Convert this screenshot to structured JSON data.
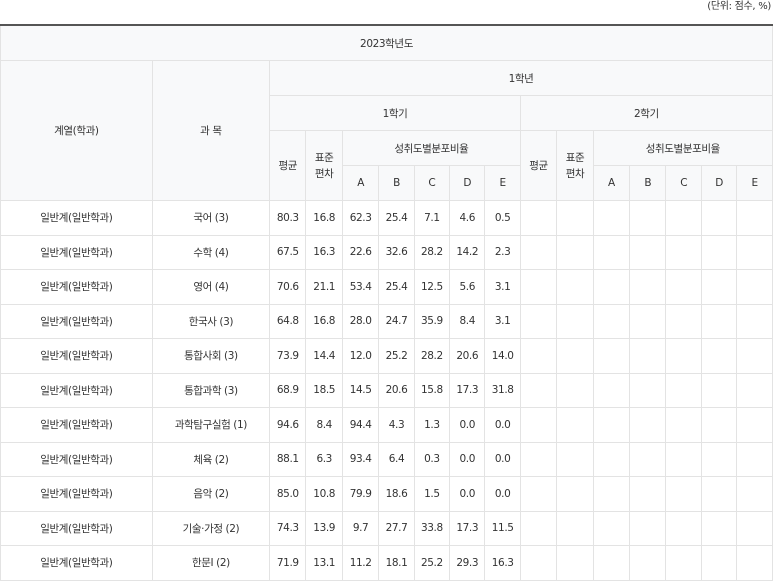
{
  "unit_note": "(단위: 점수, %)",
  "header": {
    "year": "2023학년도",
    "track_col": "계열(학과)",
    "subject_col": "과 목",
    "grade": "1학년",
    "semester1": "1학기",
    "semester2": "2학기",
    "avg": "평균",
    "std_line1": "표준",
    "std_line2": "편차",
    "dist": "성취도별분포비율",
    "levels": [
      "A",
      "B",
      "C",
      "D",
      "E"
    ]
  },
  "rows": [
    {
      "track": "일반계(일반학과)",
      "subject": "국어 (3)",
      "avg": "80.3",
      "std": "16.8",
      "a": "62.3",
      "b": "25.4",
      "c": "7.1",
      "d": "4.6",
      "e": "0.5"
    },
    {
      "track": "일반계(일반학과)",
      "subject": "수학 (4)",
      "avg": "67.5",
      "std": "16.3",
      "a": "22.6",
      "b": "32.6",
      "c": "28.2",
      "d": "14.2",
      "e": "2.3"
    },
    {
      "track": "일반계(일반학과)",
      "subject": "영어 (4)",
      "avg": "70.6",
      "std": "21.1",
      "a": "53.4",
      "b": "25.4",
      "c": "12.5",
      "d": "5.6",
      "e": "3.1"
    },
    {
      "track": "일반계(일반학과)",
      "subject": "한국사 (3)",
      "avg": "64.8",
      "std": "16.8",
      "a": "28.0",
      "b": "24.7",
      "c": "35.9",
      "d": "8.4",
      "e": "3.1"
    },
    {
      "track": "일반계(일반학과)",
      "subject": "통합사회 (3)",
      "avg": "73.9",
      "std": "14.4",
      "a": "12.0",
      "b": "25.2",
      "c": "28.2",
      "d": "20.6",
      "e": "14.0"
    },
    {
      "track": "일반계(일반학과)",
      "subject": "통합과학 (3)",
      "avg": "68.9",
      "std": "18.5",
      "a": "14.5",
      "b": "20.6",
      "c": "15.8",
      "d": "17.3",
      "e": "31.8"
    },
    {
      "track": "일반계(일반학과)",
      "subject": "과학탐구실험 (1)",
      "avg": "94.6",
      "std": "8.4",
      "a": "94.4",
      "b": "4.3",
      "c": "1.3",
      "d": "0.0",
      "e": "0.0"
    },
    {
      "track": "일반계(일반학과)",
      "subject": "체육 (2)",
      "avg": "88.1",
      "std": "6.3",
      "a": "93.4",
      "b": "6.4",
      "c": "0.3",
      "d": "0.0",
      "e": "0.0"
    },
    {
      "track": "일반계(일반학과)",
      "subject": "음악 (2)",
      "avg": "85.0",
      "std": "10.8",
      "a": "79.9",
      "b": "18.6",
      "c": "1.5",
      "d": "0.0",
      "e": "0.0"
    },
    {
      "track": "일반계(일반학과)",
      "subject": "기술·가정 (2)",
      "avg": "74.3",
      "std": "13.9",
      "a": "9.7",
      "b": "27.7",
      "c": "33.8",
      "d": "17.3",
      "e": "11.5"
    },
    {
      "track": "일반계(일반학과)",
      "subject": "한문Ⅰ (2)",
      "avg": "71.9",
      "std": "13.1",
      "a": "11.2",
      "b": "18.1",
      "c": "25.2",
      "d": "29.3",
      "e": "16.3"
    }
  ]
}
